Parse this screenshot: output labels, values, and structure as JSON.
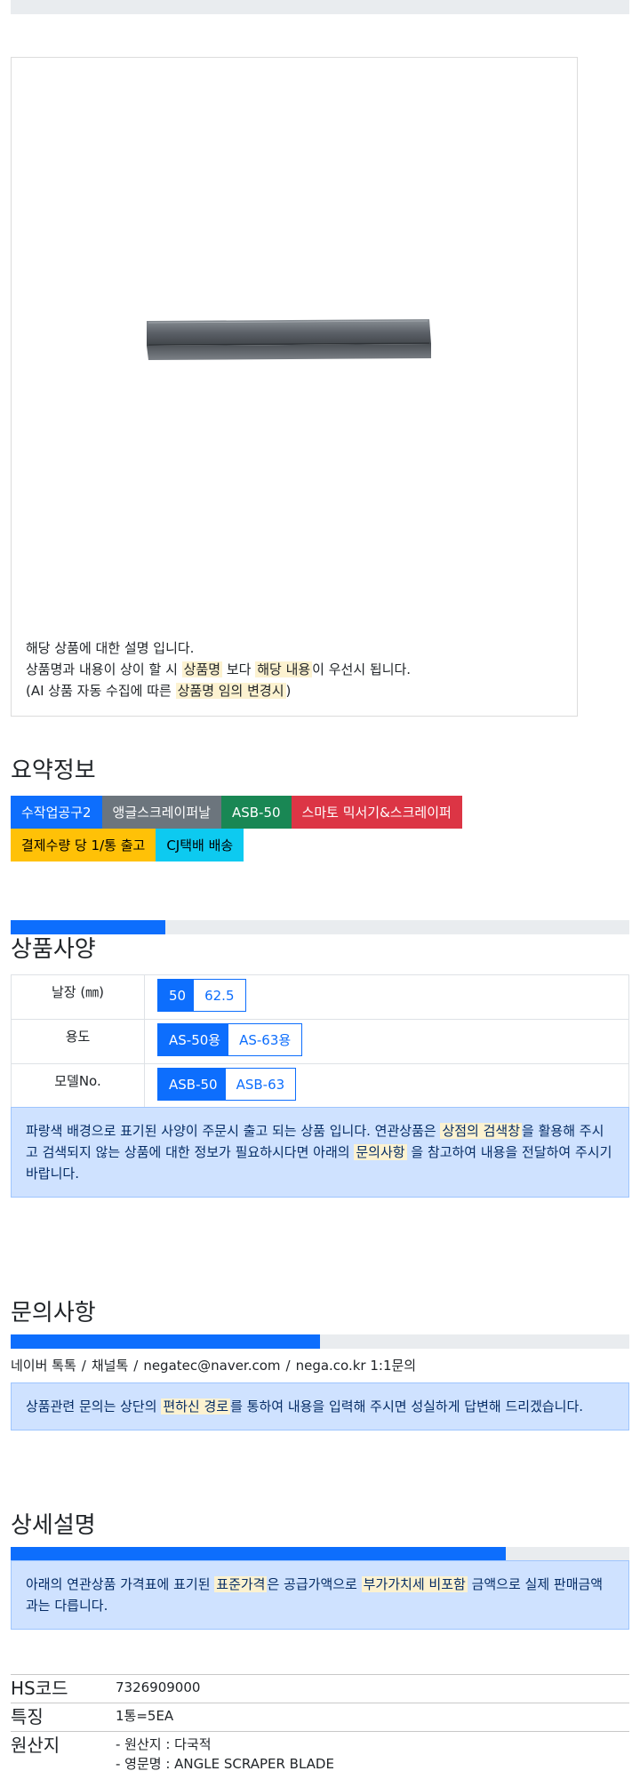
{
  "product": {
    "image_alt": "ASB-50 scraper blade",
    "desc_line1": "해당 상품에 대한 설명 입니다.",
    "desc_line2_pre": "상품명과 내용이 상이 할 시 ",
    "desc_line2_mark1": "상품명",
    "desc_line2_mid": " 보다 ",
    "desc_line2_mark2": "해당 내용",
    "desc_line2_post": "이 우선시 됩니다.",
    "desc_line3_pre": "(AI 상품 자동 수집에 따른 ",
    "desc_line3_mark": "상품명 임의 변경시",
    "desc_line3_post": ")"
  },
  "summary": {
    "title": "요약정보",
    "badges_row1": [
      "수작업공구2",
      "앵글스크레이퍼날",
      "ASB-50",
      "스마토 믹서기&스크레이퍼"
    ],
    "badges_row2": [
      "결제수량 당 1/통 출고",
      "CJ택배 배송"
    ],
    "badge_colors": [
      "#0d6efd",
      "#6c757d",
      "#198754",
      "#dc3545",
      "#ffc107",
      "#0dcaf0"
    ]
  },
  "spec": {
    "progress_fraction": 0.25,
    "title": "상품사양",
    "rows": [
      {
        "label": "날장 (㎜)",
        "options": [
          "50",
          "62.5"
        ],
        "selected": 0
      },
      {
        "label": "용도",
        "options": [
          "AS-50용",
          "AS-63용"
        ],
        "selected": 0
      },
      {
        "label": "모델No.",
        "options": [
          "ASB-50",
          "ASB-63"
        ],
        "selected": 0
      }
    ],
    "notice_pre": "파랑색 배경으로 표기된 사양이 주문시 출고 되는 상품 입니다. 연관상품은 ",
    "notice_mark1": "상점의 검색창",
    "notice_mid": "을 활용해 주시고 검색되지 않는 상품에 대한 정보가 필요하시다면 아래의 ",
    "notice_mark2": "문의사항",
    "notice_post": " 을 참고하여 내용을 전달하여 주시기 바랍니다."
  },
  "inquiry": {
    "title": "문의사항",
    "progress_fraction": 0.5,
    "contacts": [
      "네이버 톡톡",
      "채널톡",
      "negatec@naver.com",
      "nega.co.kr 1:1문의"
    ],
    "separator": "/",
    "notice_pre": "상품관련 문의는 상단의 ",
    "notice_mark": "편하신 경로",
    "notice_post": "를 통하여 내용을 입력해 주시면 성실하게 답변해 드리겠습니다."
  },
  "detail": {
    "title": "상세설명",
    "progress_fraction": 0.8,
    "notice_pre": "아래의 연관상품 가격표에 표기된 ",
    "notice_mark1": "표준가격",
    "notice_mid": "은 공급가액으로 ",
    "notice_mark2": "부가가치세 비포함",
    "notice_post": " 금액으로 실제 판매금액과는 다릅니다.",
    "info": [
      {
        "key": "HS코드",
        "values": [
          "7326909000"
        ]
      },
      {
        "key": "특징",
        "values": [
          "1통=5EA"
        ]
      },
      {
        "key": "원산지",
        "values": [
          "- 원산지 : 다국적",
          "- 영문명 : ANGLE SCRAPER BLADE"
        ]
      }
    ]
  }
}
